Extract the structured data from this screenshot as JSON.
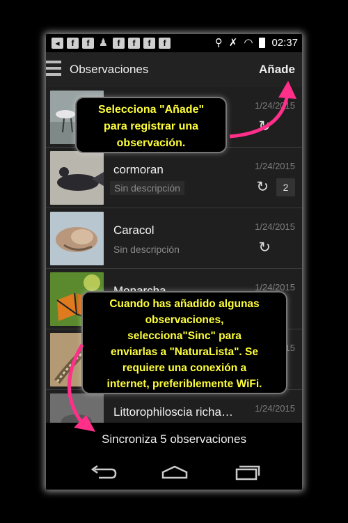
{
  "status_bar": {
    "notification_icons": [
      "bell-icon",
      "facebook-icon",
      "facebook-icon",
      "person-icon",
      "facebook-icon",
      "facebook-icon",
      "facebook-icon",
      "facebook-icon"
    ],
    "time": "02:37"
  },
  "action_bar": {
    "title": "Observaciones",
    "add_label": "Añade"
  },
  "observations": [
    {
      "name": "",
      "description": "",
      "date": "1/24/2015",
      "sync": true,
      "count": ""
    },
    {
      "name": "cormoran",
      "description": "Sin descripción",
      "date": "1/24/2015",
      "sync": true,
      "count": "2"
    },
    {
      "name": "Caracol",
      "description": "Sin descripción",
      "date": "1/24/2015",
      "sync": true,
      "count": ""
    },
    {
      "name": "Monarcha",
      "description": "",
      "date": "1/24/2015",
      "sync": false,
      "count": ""
    },
    {
      "name": "",
      "description": "",
      "date": "1/24/2015",
      "sync": false,
      "count": ""
    },
    {
      "name": "Littorophiloscia richa…",
      "description": "",
      "date": "1/24/2015",
      "sync": false,
      "count": ""
    }
  ],
  "sync_bar": {
    "label": "Sincroniza 5 observaciones"
  },
  "tooltips": {
    "add_tip": [
      "Selecciona \"Añade\"",
      "para registrar una",
      "observación."
    ],
    "sync_tip": [
      "Cuando has añadido algunas",
      "observaciones,",
      "selecciona\"Sinc\" para",
      "enviarlas a \"NaturaLista\". Se",
      "requiere una conexión a",
      "internet, preferiblemente WiFi."
    ]
  },
  "colors": {
    "tooltip_text": "#ffff3c",
    "arrow": "#ff2f8a",
    "background": "#1e1e1e"
  }
}
